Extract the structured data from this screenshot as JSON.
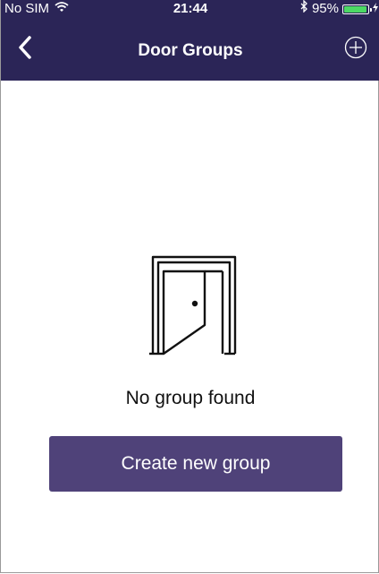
{
  "status_bar": {
    "carrier": "No SIM",
    "time": "21:44",
    "battery_text": "95%",
    "battery_level": 0.95,
    "wifi_icon": "wifi-icon",
    "bluetooth_icon": "bluetooth-icon",
    "charging_icon": "charging-bolt-icon"
  },
  "header": {
    "title": "Door Groups",
    "back_icon": "chevron-left-icon",
    "add_icon": "plus-circle-icon"
  },
  "empty_state": {
    "icon": "open-door-icon",
    "message": "No group found",
    "button_label": "Create new group"
  },
  "colors": {
    "header_background": "#2b2557",
    "button_background": "#4f4279",
    "battery_fill": "#4cd964"
  }
}
